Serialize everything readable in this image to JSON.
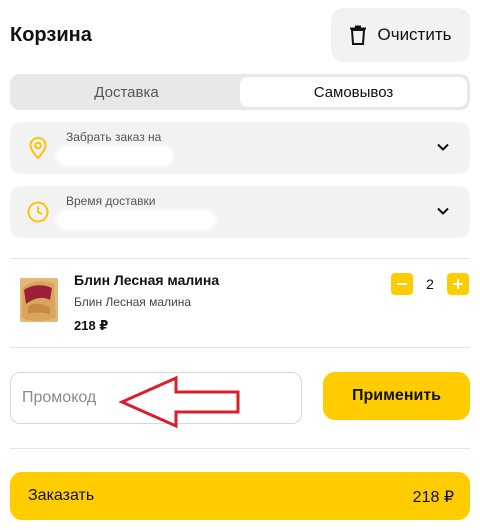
{
  "header": {
    "title": "Корзина",
    "clear_label": "Очистить"
  },
  "delivery_tabs": {
    "options": [
      "Доставка",
      "Самовывоз"
    ],
    "selected": "Самовывоз"
  },
  "pickup_field": {
    "label": "Забрать заказ на",
    "icon": "location-pin-icon"
  },
  "time_field": {
    "label": "Время доставки",
    "icon": "clock-icon"
  },
  "cart": {
    "items": [
      {
        "name": "Блин Лесная малина",
        "description": "Блин Лесная малина",
        "price": "218 ₽",
        "quantity": "2"
      }
    ]
  },
  "promo": {
    "placeholder": "Промокод",
    "value": "",
    "apply_label": "Применить"
  },
  "order": {
    "label": "Заказать",
    "total": "218 ₽"
  },
  "colors": {
    "accent": "#ffcc00",
    "annotation_arrow": "#d81e2a",
    "field_bg": "#f2f2f2"
  }
}
